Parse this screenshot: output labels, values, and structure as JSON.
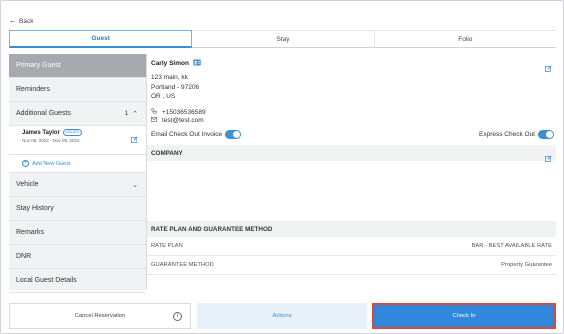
{
  "nav": {
    "back_label": "Back"
  },
  "tabs": [
    {
      "label": "Guest",
      "active": true
    },
    {
      "label": "Stay",
      "active": false
    },
    {
      "label": "Folio",
      "active": false
    }
  ],
  "sidebar": {
    "primary_guest": "Primary Guest",
    "reminders": "Reminders",
    "additional_guests": {
      "label": "Additional Guests",
      "count": "1"
    },
    "guest": {
      "name": "James Taylor",
      "badge": "ADDED",
      "dates": "Nov 08, 2022 - Nov 09, 2022"
    },
    "add_guest": "Add New Guest",
    "vehicle": "Vehicle",
    "stay_history": "Stay History",
    "remarks": "Remarks",
    "dnr": "DNR",
    "local_guest_details": "Local Guest Details"
  },
  "guest": {
    "name": "Carly Simon",
    "address_lines": [
      "123 main, kk",
      "Portland - 97206",
      "OR , US"
    ],
    "phone": "+15036536589",
    "email": "test@test.com",
    "email_checkout_invoice_label": "Email Check Out Invoice",
    "express_checkout_label": "Express Check Out"
  },
  "company": {
    "title": "COMPANY"
  },
  "rate_plan": {
    "title": "RATE PLAN AND GUARANTEE METHOD",
    "rate_plan_label": "RATE PLAN",
    "rate_plan_value": "BAR - BEST AVAILABLE RATE",
    "guarantee_label": "GUARANTEE METHOD",
    "guarantee_value": "Property Guarantee"
  },
  "footer": {
    "cancel_label": "Cancel Reservation",
    "actions_label": "Actions",
    "checkin_label": "Check In"
  },
  "colors": {
    "accent": "#3d8fd1",
    "checkin_bg": "#2f88dc",
    "checkin_border": "#e0453a",
    "sidebar_active": "#a6a9ad"
  }
}
